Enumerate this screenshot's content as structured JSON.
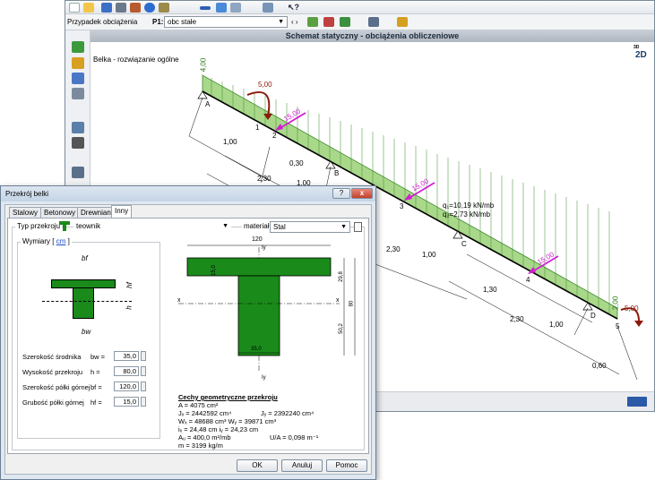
{
  "toolbar": {
    "load_case_label": "Przypadek obciążenia",
    "load_case_code": "P1:",
    "load_case_value": "obc stałe",
    "nav_arrows": "‹ ›"
  },
  "canvas": {
    "title": "Schemat statyczny - obciążenia obliczeniowe",
    "subtitle": "Belka - rozwiązanie ogólne",
    "view_toggle_top": "3D",
    "view_toggle": "2D",
    "supports": [
      "A",
      "B",
      "C",
      "D"
    ],
    "nodes": [
      "1",
      "2",
      "3",
      "4",
      "5"
    ],
    "loads": {
      "dist_start": "4,00",
      "dist_end": "2,00",
      "moment_left": "5,00",
      "moment_right": "5,00",
      "force1": "15,00",
      "force2": "15,00",
      "force3": "15,00",
      "dist_value_q1": "q₁=10,19 kN/mb",
      "dist_value_q2": "q₂=2,73 kN/mb"
    },
    "dims": {
      "d1": "1,00",
      "d2": "0,30",
      "d3": "2,30",
      "d4": "1,00",
      "d5": "2,30",
      "d6": "1,00",
      "d7": "1,30",
      "d8": "2,30",
      "d9": "1,00",
      "d10": "0,60"
    }
  },
  "dialog": {
    "title": "Przekrój belki",
    "help": "?",
    "close": "x",
    "tabs": [
      "Stalowy",
      "Betonowy",
      "Drewniany",
      "Inny"
    ],
    "type_label": "Typ przekroju",
    "type_value": "teownik",
    "material_label": "materiał",
    "material_value": "Stal",
    "dims_group": "Wymiary [",
    "dims_unit": "cm",
    "dims_close": "]",
    "sketch_labels": {
      "bf": "bf",
      "hf": "hf",
      "h": "h",
      "bw": "bw"
    },
    "fields": [
      {
        "label": "Szerokość środnika",
        "sym": "bw =",
        "value": "35,0"
      },
      {
        "label": "Wysokość przekroju",
        "sym": "h =",
        "value": "80,0"
      },
      {
        "label": "Szerokość półki górnej",
        "sym": "bf =",
        "value": "120,0"
      },
      {
        "label": "Grubość półki górnej",
        "sym": "hf =",
        "value": "15,0"
      }
    ],
    "drawing": {
      "top_width": "120",
      "iy_top": "Iy",
      "iy_bottom": "Iy",
      "flange_thk": "15,0",
      "web_width": "35,0",
      "height": "80",
      "upper": "29,8",
      "lower": "50,2",
      "axis_x_left": "x",
      "axis_x_right": "x"
    },
    "geo_title": "Cechy geometryczne przekroju",
    "geo": {
      "A": "A = 4075 cm²",
      "Jx": "Jₓ = 2442592 cm⁴",
      "Jy": "Jᵧ = 2392240 cm⁴",
      "W": "Wₓ = 48688 cm³   Wᵧ = 39871 cm³",
      "i": "iₓ = 24,48 cm      iᵧ = 24,23 cm",
      "Au": "Aᵤ = 400,0 m²/mb",
      "UA": "U/A = 0,098 m⁻¹",
      "m": "m = 3199 kg/m"
    },
    "buttons": {
      "ok": "OK",
      "cancel": "Anuluj",
      "help": "Pomoc"
    }
  },
  "colors": {
    "load_fill": "#5ea840",
    "force": "#d21ed2",
    "moment": "#8b1a0a",
    "section": "#1a8a1a"
  }
}
